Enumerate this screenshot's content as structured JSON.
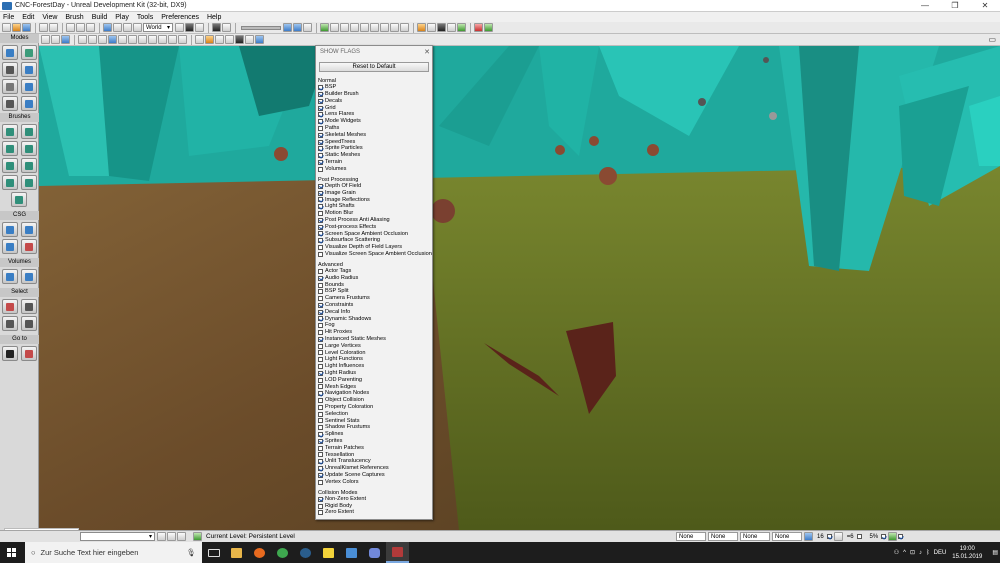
{
  "window": {
    "title": "CNC-ForestDay - Unreal Development Kit (32-bit, DX9)",
    "minimize_glyph": "—",
    "maximize_glyph": "❐",
    "close_glyph": "✕"
  },
  "menu": [
    "File",
    "Edit",
    "View",
    "Brush",
    "Build",
    "Play",
    "Tools",
    "Preferences",
    "Help"
  ],
  "toolbar": {
    "coord_system": "World"
  },
  "sidebar": {
    "sections": [
      "Modes",
      "Brushes",
      "CSG",
      "Volumes",
      "Select",
      "Go to"
    ]
  },
  "show_flags": {
    "title": "SHOW FLAGS",
    "close_glyph": "✕",
    "reset_label": "Reset to Default",
    "groups": [
      {
        "name": "Normal",
        "items": [
          {
            "label": "BSP",
            "checked": true
          },
          {
            "label": "Builder Brush",
            "checked": true
          },
          {
            "label": "Decals",
            "checked": true
          },
          {
            "label": "Grid",
            "checked": true
          },
          {
            "label": "Lens Flares",
            "checked": true
          },
          {
            "label": "Mode Widgets",
            "checked": true
          },
          {
            "label": "Paths",
            "checked": false
          },
          {
            "label": "Skeletal Meshes",
            "checked": true
          },
          {
            "label": "SpeedTrees",
            "checked": true
          },
          {
            "label": "Sprite Particles",
            "checked": true
          },
          {
            "label": "Static Meshes",
            "checked": true
          },
          {
            "label": "Terrain",
            "checked": true
          },
          {
            "label": "Volumes",
            "checked": false
          }
        ]
      },
      {
        "name": "Post Processing",
        "items": [
          {
            "label": "Depth Of Field",
            "checked": true
          },
          {
            "label": "Image Grain",
            "checked": true
          },
          {
            "label": "Image Reflections",
            "checked": true
          },
          {
            "label": "Light Shafts",
            "checked": true
          },
          {
            "label": "Motion Blur",
            "checked": false
          },
          {
            "label": "Post Process Anti Aliasing",
            "checked": true
          },
          {
            "label": "Post-process Effects",
            "checked": true
          },
          {
            "label": "Screen Space Ambient Occlusion",
            "checked": true
          },
          {
            "label": "Subsurface Scattering",
            "checked": true
          },
          {
            "label": "Visualize Depth of Field Layers",
            "checked": false
          },
          {
            "label": "Visualize Screen Space Ambient Occlusion",
            "checked": false
          }
        ]
      },
      {
        "name": "Advanced",
        "items": [
          {
            "label": "Actor Tags",
            "checked": false
          },
          {
            "label": "Audio Radius",
            "checked": true
          },
          {
            "label": "Bounds",
            "checked": false
          },
          {
            "label": "BSP Split",
            "checked": false
          },
          {
            "label": "Camera Frustums",
            "checked": false
          },
          {
            "label": "Constraints",
            "checked": true
          },
          {
            "label": "Decal Info",
            "checked": true
          },
          {
            "label": "Dynamic Shadows",
            "checked": true
          },
          {
            "label": "Fog",
            "checked": false
          },
          {
            "label": "Hit Proxies",
            "checked": false
          },
          {
            "label": "Instanced Static Meshes",
            "checked": true
          },
          {
            "label": "Large Vertices",
            "checked": false
          },
          {
            "label": "Level Coloration",
            "checked": false
          },
          {
            "label": "Light Functions",
            "checked": false
          },
          {
            "label": "Light Influences",
            "checked": false
          },
          {
            "label": "Light Radius",
            "checked": true
          },
          {
            "label": "LOD Parenting",
            "checked": false
          },
          {
            "label": "Mesh Edges",
            "checked": false
          },
          {
            "label": "Navigation Nodes",
            "checked": true
          },
          {
            "label": "Object Collision",
            "checked": false
          },
          {
            "label": "Property Coloration",
            "checked": false
          },
          {
            "label": "Selection",
            "checked": false
          },
          {
            "label": "Sentinel Stats",
            "checked": false
          },
          {
            "label": "Shadow Frustums",
            "checked": false
          },
          {
            "label": "Splines",
            "checked": true
          },
          {
            "label": "Sprites",
            "checked": true
          },
          {
            "label": "Terrain Patches",
            "checked": false
          },
          {
            "label": "Tessellation",
            "checked": false
          },
          {
            "label": "Unlit Translucency",
            "checked": true
          },
          {
            "label": "UnrealKismet References",
            "checked": true
          },
          {
            "label": "Update Scene Captures",
            "checked": true
          },
          {
            "label": "Vertex Colors",
            "checked": false
          }
        ]
      },
      {
        "name": "Collision Modes",
        "items": [
          {
            "label": "Non-Zero Extent",
            "checked": true
          },
          {
            "label": "Rigid Body",
            "checked": false
          },
          {
            "label": "Zero Extent",
            "checked": false
          }
        ]
      }
    ]
  },
  "statusbar": {
    "current_level": "Current Level:  Persistent Level",
    "fields": [
      "None",
      "None",
      "None",
      "None"
    ],
    "grid": "16",
    "rotation": "=6",
    "scale": "5%"
  },
  "taskbar": {
    "search_placeholder": "Zur Suche Text hier eingeben",
    "language": "DEU",
    "time": "19:00",
    "date": "15.01.2019"
  },
  "colors": {
    "crystal": "#1fb5a8",
    "sky": "#24c3b6",
    "ground_dirt": "#6b4c2a",
    "ground_grass": "#6d7a2a",
    "accent_blue": "#2f79c8"
  }
}
